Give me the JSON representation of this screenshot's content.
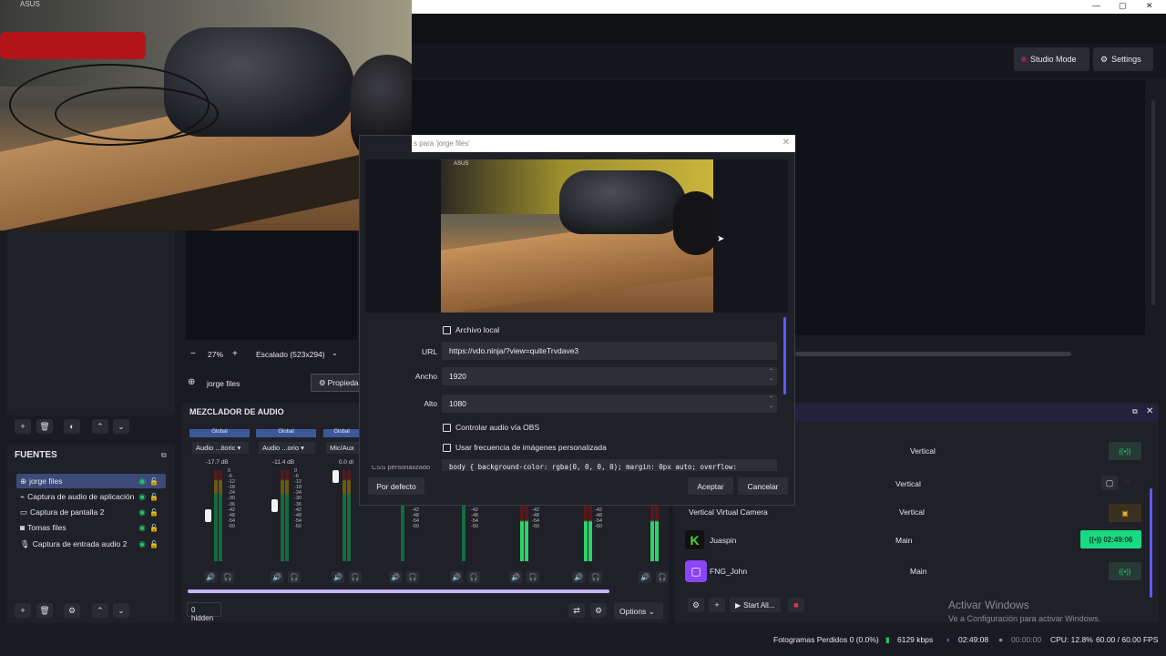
{
  "window": {
    "close_symbol": "✕",
    "max_symbol": "▢",
    "min_symbol": "—"
  },
  "toolbar": {
    "studio_mode": "Studio Mode",
    "settings": "Settings"
  },
  "preview_photo": {
    "logo": "ASUS"
  },
  "canvas": {
    "zoom_minus": "−",
    "zoom_value": "27%",
    "zoom_plus": "+",
    "scale_label": "Escalado (523x294)"
  },
  "source_bar": {
    "name": "jorge files",
    "props_button": "Propiedades"
  },
  "sources": {
    "title": "FUENTES",
    "items": [
      {
        "label": "jorge files",
        "icon": "globe-icon",
        "selected": true
      },
      {
        "label": "Captura de audio de aplicación",
        "icon": "audio-app-icon",
        "selected": false
      },
      {
        "label": "Captura de pantalla 2",
        "icon": "monitor-icon",
        "selected": false
      },
      {
        "label": "Tomas files",
        "icon": "camera-icon",
        "selected": false
      },
      {
        "label": "Captura de entrada audio 2",
        "icon": "microphone-icon",
        "selected": false
      }
    ]
  },
  "mixer": {
    "title": "MEZCLADOR DE AUDIO",
    "global_label": "Global",
    "channels": [
      {
        "select": "Audio ...itoric",
        "db": "-17.7 dB"
      },
      {
        "select": "Audio ...orio",
        "db": "-11.4 dB"
      },
      {
        "select": "Mic/Aux",
        "db": "0.0 dl"
      }
    ],
    "scale": [
      "0",
      "-6",
      "-12",
      "-18",
      "-24",
      "-30",
      "-36",
      "-42",
      "-48",
      "-54",
      "-60"
    ],
    "hidden_label": "0 hidden",
    "options_label": "Options"
  },
  "dialog": {
    "title": "s para 'jorge files'",
    "image_logo": "ASUS",
    "archivo_local": "Archivo local",
    "url_label": "URL",
    "url_value": "https://vdo.ninja/?view=quiteTrvdave3",
    "ancho_label": "Ancho",
    "ancho_value": "1920",
    "alto_label": "Alto",
    "alto_value": "1080",
    "controlar_audio": "Controlar audio vía OBS",
    "frecuencia": "Usar frecuencia de imágenes personalizada",
    "css_label": "CSS personalizado",
    "css_value": "body { background-color: rgba(0, 0, 0, 0); margin: 0px auto; overflow:",
    "defaults_button": "Por defecto",
    "ok_button": "Aceptar",
    "cancel_button": "Cancelar"
  },
  "outputs": {
    "rows": [
      {
        "name": "",
        "type": "Vertical"
      },
      {
        "name": "",
        "type": "Vertical"
      },
      {
        "name": "Vertical Virtual Camera",
        "type": "Vertical"
      },
      {
        "name": "Juaspin",
        "type": "Main",
        "timer": "02:49:06"
      },
      {
        "name": "FNG_John",
        "type": "Main"
      }
    ],
    "start_all": "Start All..."
  },
  "watermark": {
    "line1": "Activar Windows",
    "line2": "Ve a Configuración para activar Windows."
  },
  "statusbar": {
    "dropped": "Fotogramas Perdidos 0 (0.0%)",
    "kbps": "6129 kbps",
    "stream_time": "02:49:08",
    "rec_time": "00:00:00",
    "cpu": "CPU: 12.8%",
    "fps": "60.00 / 60.00 FPS"
  },
  "colors": {
    "accent": "#5c5ef0",
    "live_green": "#19d983",
    "selected_source": "#3b4a79"
  }
}
